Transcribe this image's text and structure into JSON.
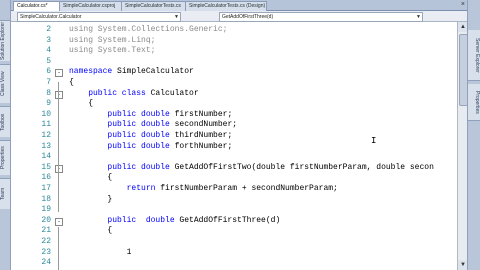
{
  "left_strip": {
    "tabs": [
      "Solution Explorer",
      "Class View",
      "Toolbox",
      "Properties",
      "Team"
    ]
  },
  "right_strip": {
    "tabs": [
      "Server Explorer",
      "Properties"
    ]
  },
  "tabs": [
    {
      "label": "Calculator.cs*",
      "active": true
    },
    {
      "label": "SimpleCalculator.csproj",
      "active": false
    },
    {
      "label": "SimpleCalculatorTests.cs",
      "active": false
    },
    {
      "label": "SimpleCalculatorTests.cs (Design)",
      "active": false
    }
  ],
  "nav": {
    "class_combo": "SimpleCalculator.Calculator",
    "member_combo": "GetAddOfFirstThree(d)"
  },
  "lines": [
    {
      "n": "2",
      "text": "using System.Collections.Generic;",
      "dim": true
    },
    {
      "n": "3",
      "text": "using System.Linq;",
      "dim": true
    },
    {
      "n": "4",
      "text": "using System.Text;",
      "dim": true
    },
    {
      "n": "5",
      "text": ""
    },
    {
      "n": "6",
      "kw": "namespace",
      "rest": " SimpleCalculator"
    },
    {
      "n": "7",
      "text": "{"
    },
    {
      "n": "8",
      "kw": "    public class",
      "rest": " Calculator"
    },
    {
      "n": "9",
      "text": "    {"
    },
    {
      "n": "10",
      "kw": "        public double",
      "rest": " firstNumber;"
    },
    {
      "n": "11",
      "kw": "        public double",
      "rest": " secondNumber;"
    },
    {
      "n": "12",
      "kw": "        public double",
      "rest": " thirdNumber;"
    },
    {
      "n": "13",
      "kw": "        public double",
      "rest": " forthNumber;"
    },
    {
      "n": "14",
      "text": ""
    },
    {
      "n": "15",
      "kw": "        public double",
      "rest": " GetAddOfFirstTwo(double firstNumberParam, double secon"
    },
    {
      "n": "16",
      "text": "        {"
    },
    {
      "n": "17",
      "kw": "            return",
      "rest": " firstNumberParam + secondNumberParam;"
    },
    {
      "n": "18",
      "text": "        }"
    },
    {
      "n": "19",
      "text": ""
    },
    {
      "n": "20",
      "kw": "        public  double",
      "rest": " GetAddOfFirstThree(d)"
    },
    {
      "n": "21",
      "text": "        {"
    },
    {
      "n": "22",
      "text": ""
    },
    {
      "n": "23",
      "text": "            1"
    },
    {
      "n": "24",
      "text": ""
    }
  ]
}
